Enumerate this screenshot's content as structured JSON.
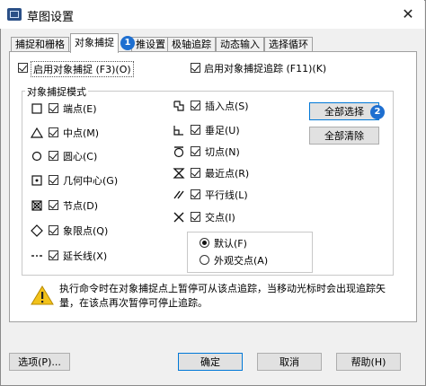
{
  "window": {
    "title": "草图设置",
    "close_label": "✕"
  },
  "tabs": [
    {
      "label": "捕捉和栅格"
    },
    {
      "label": "对象捕捉"
    },
    {
      "label": "推设置"
    },
    {
      "label": "极轴追踪"
    },
    {
      "label": "动态输入"
    },
    {
      "label": "选择循环"
    }
  ],
  "top_checks": {
    "enable_snap": {
      "label": "启用对象捕捉 (F3)(O)",
      "checked": true
    },
    "enable_tracking": {
      "label": "启用对象捕捉追踪 (F11)(K)",
      "checked": true
    }
  },
  "group_title": "对象捕捉模式",
  "left_modes": [
    {
      "label": "端点(E)",
      "symbol": "square-icon",
      "checked": true
    },
    {
      "label": "中点(M)",
      "symbol": "triangle-icon",
      "checked": true
    },
    {
      "label": "圆心(C)",
      "symbol": "circle-icon",
      "checked": true
    },
    {
      "label": "几何中心(G)",
      "symbol": "dot-square-icon",
      "checked": true
    },
    {
      "label": "节点(D)",
      "symbol": "node-icon",
      "checked": true
    },
    {
      "label": "象限点(Q)",
      "symbol": "diamond-icon",
      "checked": true
    },
    {
      "label": "延长线(X)",
      "symbol": "extension-icon",
      "checked": true
    }
  ],
  "right_modes": [
    {
      "label": "插入点(S)",
      "symbol": "insert-icon",
      "checked": true
    },
    {
      "label": "垂足(U)",
      "symbol": "perpendicular-icon",
      "checked": true
    },
    {
      "label": "切点(N)",
      "symbol": "tangent-icon",
      "checked": true
    },
    {
      "label": "最近点(R)",
      "symbol": "nearest-icon",
      "checked": true
    },
    {
      "label": "平行线(L)",
      "symbol": "parallel-icon",
      "checked": true
    },
    {
      "label": "交点(I)",
      "symbol": "intersection-icon",
      "checked": true
    }
  ],
  "buttons": {
    "select_all": "全部选择",
    "clear_all": "全部清除"
  },
  "radio_options": [
    {
      "label": "默认(F)",
      "selected": true
    },
    {
      "label": "外观交点(A)",
      "selected": false
    }
  ],
  "note": "执行命令时在对象捕捉点上暂停可从该点追踪，当移动光标时会出现追踪矢量，在该点再次暂停可停止追踪。",
  "footer": {
    "options": "选项(P)...",
    "ok": "确定",
    "cancel": "取消",
    "help": "帮助(H)"
  },
  "badges": [
    "1",
    "2"
  ],
  "accent_color": "#1e6fd0"
}
